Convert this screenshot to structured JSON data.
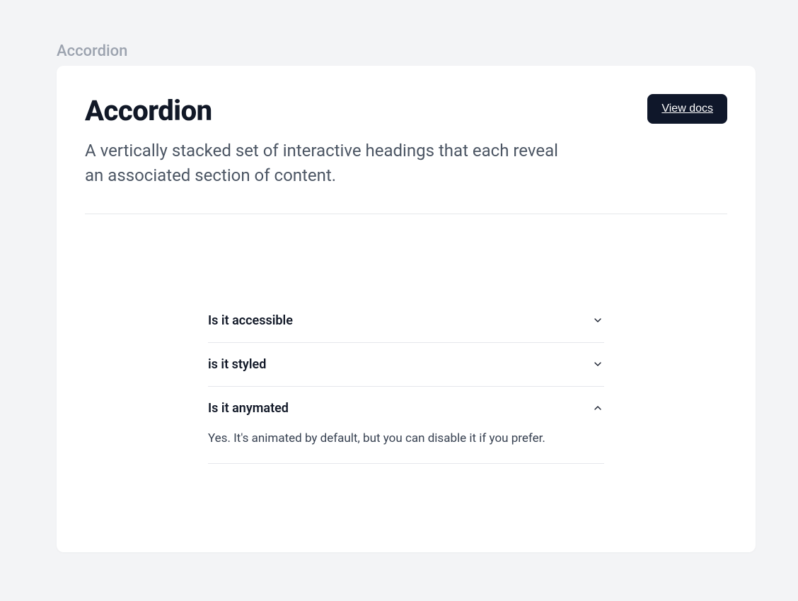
{
  "breadcrumb": "Accordion",
  "header": {
    "title": "Accordion",
    "description": "A vertically stacked set of interactive headings that each reveal an associated section of content.",
    "view_docs_label": "View docs"
  },
  "accordion": {
    "items": [
      {
        "title": "Is it accessible",
        "expanded": false,
        "content": ""
      },
      {
        "title": "is it styled",
        "expanded": false,
        "content": ""
      },
      {
        "title": "Is it anymated",
        "expanded": true,
        "content": "Yes. It's animated by default, but you can disable it if you prefer."
      }
    ]
  }
}
